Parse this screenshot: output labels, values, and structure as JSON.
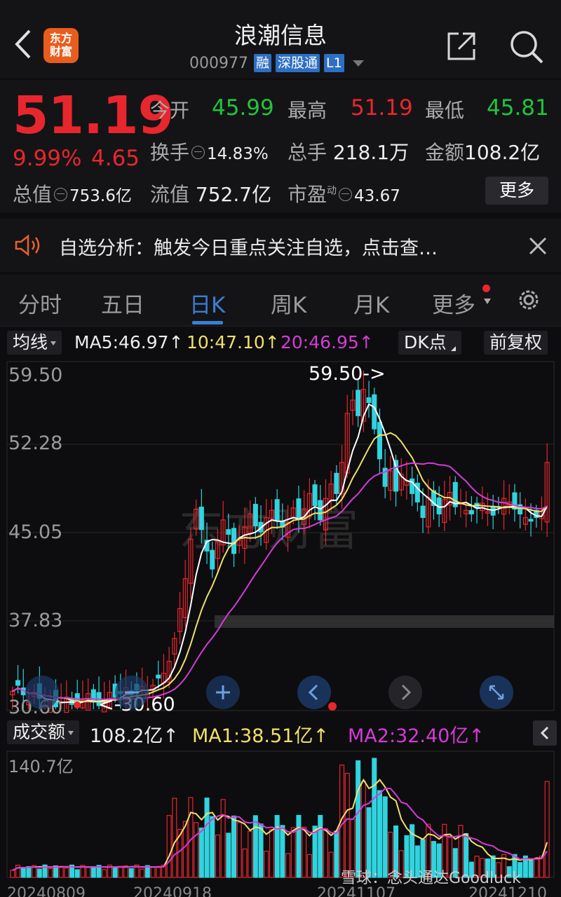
{
  "header": {
    "back_icon": "chevron-left-icon",
    "logo_line1": "东方",
    "logo_line2": "财富",
    "title": "浪潮信息",
    "code": "000977",
    "tags": [
      "融",
      "深股通",
      "L1"
    ],
    "share_icon": "share-icon",
    "search_icon": "search-icon"
  },
  "quote": {
    "price": "51.19",
    "change_pct": "9.99%",
    "change_amt": "4.65",
    "open_label": "今开",
    "open": "45.99",
    "high_label": "最高",
    "high": "51.19",
    "low_label": "最低",
    "low": "45.81",
    "turnover_label": "换手",
    "turnover": "14.83%",
    "volume_label": "总手",
    "volume": "218.1万",
    "amount_label": "金额",
    "amount": "108.2亿",
    "mktcap_label": "总值",
    "mktcap": "753.6亿",
    "float_label": "流值",
    "float_cap": "752.7亿",
    "pe_label": "市盈",
    "pe_sup": "动",
    "pe": "43.67",
    "more_label": "更多"
  },
  "notice": {
    "text": "自选分析：触发今日重点关注自选，点击查…",
    "icon": "speaker-icon",
    "close_icon": "close-icon"
  },
  "tabs": [
    {
      "label": "分时",
      "active": false
    },
    {
      "label": "五日",
      "active": false
    },
    {
      "label": "日K",
      "active": true
    },
    {
      "label": "周K",
      "active": false
    },
    {
      "label": "月K",
      "active": false
    },
    {
      "label": "更多",
      "active": false
    }
  ],
  "kline_toolbar": {
    "indicator": "均线",
    "ma5": "MA5:46.97↑",
    "ma10": "10:47.10↑",
    "ma20": "20:46.95↑",
    "dk_label": "DK点",
    "adjust_label": "前复权"
  },
  "kline": {
    "y_labels": [
      "59.50",
      "52.28",
      "45.05",
      "37.83",
      "30.60"
    ],
    "high_marker": "59.50->",
    "low_marker": "<-30.60",
    "watermark": "东方财富",
    "colors": {
      "up": "#e8262d",
      "down": "#31d3de",
      "ma5": "#ffffff",
      "ma10": "#f0e06a",
      "ma20": "#d63ad8"
    }
  },
  "volume_toolbar": {
    "indicator": "成交额",
    "value": "108.2亿↑",
    "ma1": "MA1:38.51亿↑",
    "ma2": "MA2:32.40亿↑"
  },
  "volume": {
    "y_label": "140.7亿",
    "x_labels": [
      "20240809",
      "20240918",
      "20241107",
      "20241210"
    ],
    "watermark": "雪球：念头通达Goodluck"
  }
}
